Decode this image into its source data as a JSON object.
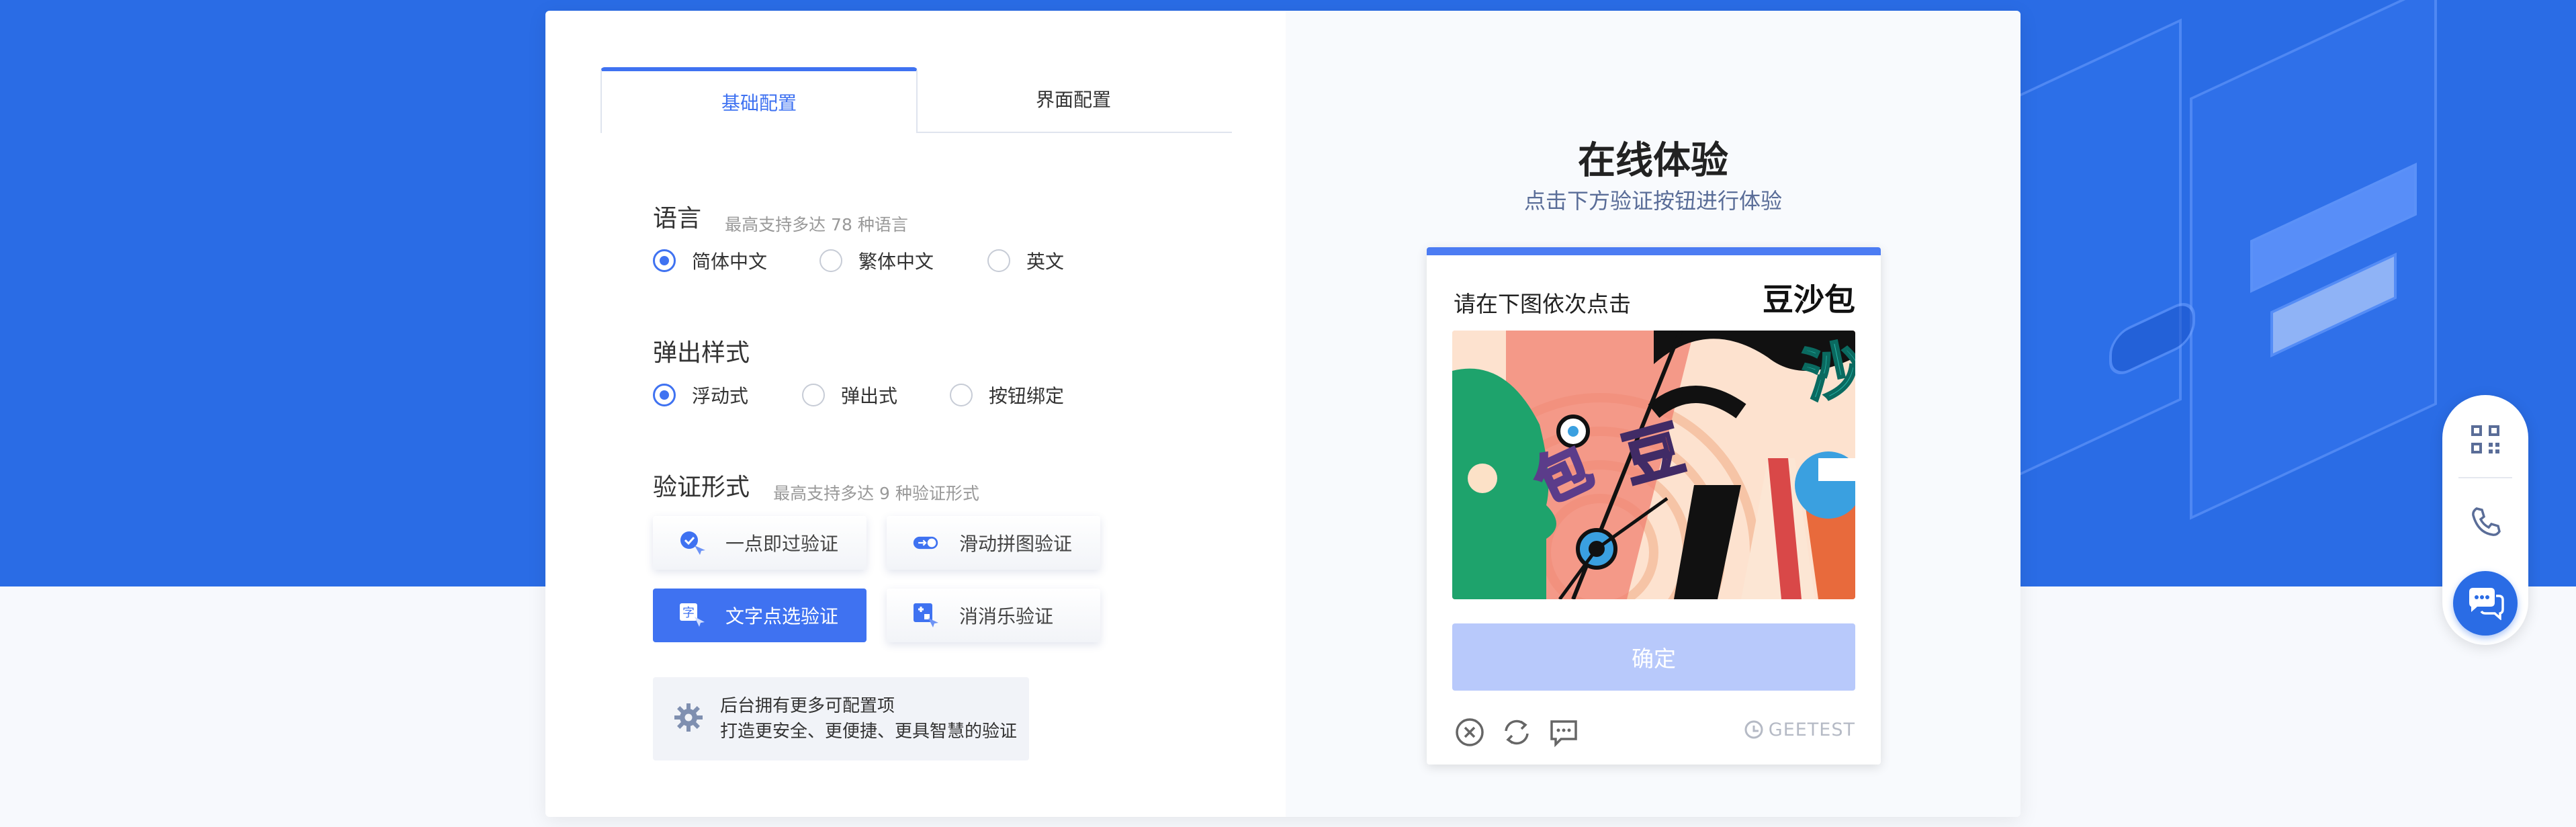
{
  "tabs": {
    "basic": "基础配置",
    "ui": "界面配置"
  },
  "language": {
    "title": "语言",
    "subtitle": "最高支持多达 78 种语言",
    "options": [
      "简体中文",
      "繁体中文",
      "英文"
    ],
    "selected": "简体中文"
  },
  "popup": {
    "title": "弹出样式",
    "options": [
      "浮动式",
      "弹出式",
      "按钮绑定"
    ],
    "selected": "浮动式"
  },
  "verify": {
    "title": "验证形式",
    "subtitle": "最高支持多达 9 种验证形式",
    "buttons": [
      "一点即过验证",
      "滑动拼图验证",
      "文字点选验证",
      "消消乐验证"
    ],
    "selected": "文字点选验证"
  },
  "info": {
    "line1": "后台拥有更多可配置项",
    "line2": "打造更安全、更便捷、更具智慧的验证"
  },
  "experience": {
    "title": "在线体验",
    "subtitle": "点击下方验证按钮进行体验"
  },
  "captcha": {
    "instruction": "请在下图依次点击",
    "target_chars": "豆沙包",
    "image_chars": [
      "沙",
      "豆",
      "包"
    ],
    "confirm": "确定",
    "brand": "GEETEST"
  },
  "colors": {
    "accent": "#3f72f1",
    "hero": "#2a6ce5",
    "confirm_disabled": "#b8c9fb"
  },
  "icons": [
    "qrcode-icon",
    "phone-icon",
    "chat-icon",
    "close-icon",
    "refresh-icon",
    "feedback-icon",
    "gear-icon"
  ]
}
